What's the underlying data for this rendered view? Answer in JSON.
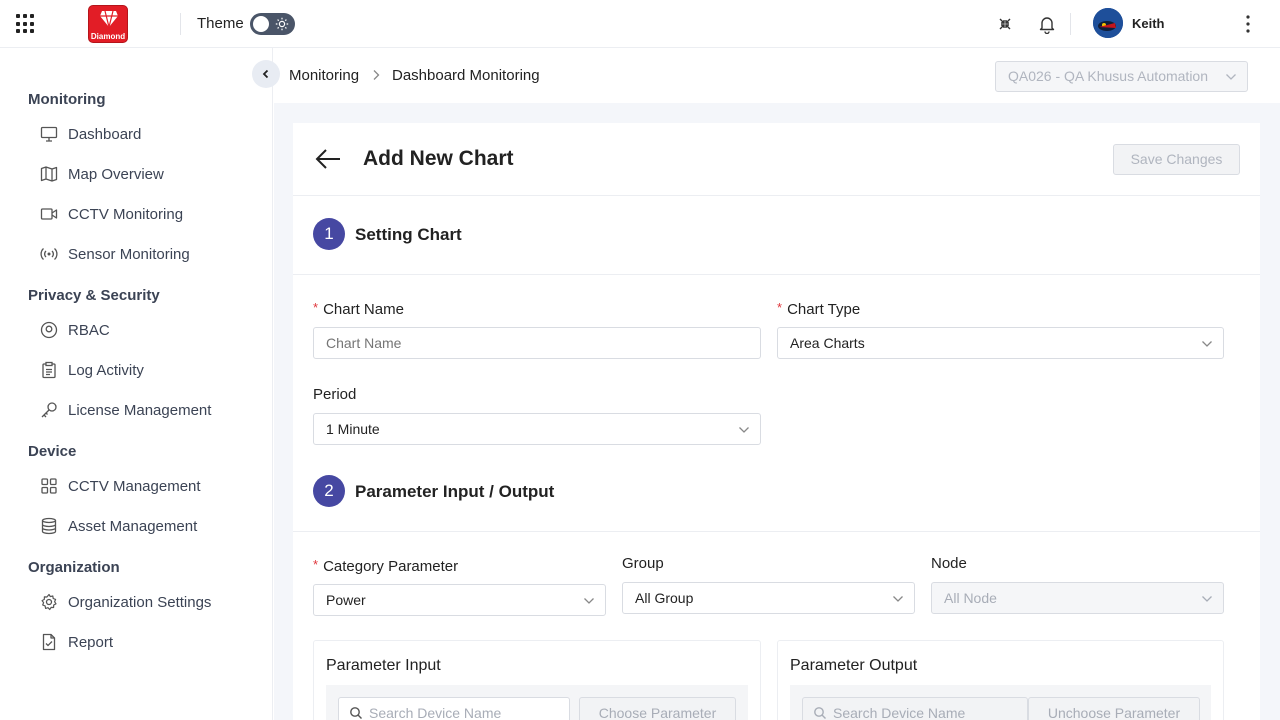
{
  "topbar": {
    "logo_text": "Diamond",
    "theme_label": "Theme",
    "user_name": "Keith"
  },
  "sidebar": {
    "sections": [
      {
        "title": "Monitoring",
        "items": [
          {
            "label": "Dashboard",
            "icon": "monitor-icon"
          },
          {
            "label": "Map Overview",
            "icon": "map-icon"
          },
          {
            "label": "CCTV Monitoring",
            "icon": "video-icon"
          },
          {
            "label": "Sensor Monitoring",
            "icon": "broadcast-icon"
          }
        ]
      },
      {
        "title": "Privacy & Security",
        "items": [
          {
            "label": "RBAC",
            "icon": "user-circle-icon"
          },
          {
            "label": "Log Activity",
            "icon": "clipboard-icon"
          },
          {
            "label": "License Management",
            "icon": "key-icon"
          }
        ]
      },
      {
        "title": "Device",
        "items": [
          {
            "label": "CCTV Management",
            "icon": "grid-icon"
          },
          {
            "label": "Asset Management",
            "icon": "database-icon"
          }
        ]
      },
      {
        "title": "Organization",
        "items": [
          {
            "label": "Organization Settings",
            "icon": "gear-icon"
          },
          {
            "label": "Report",
            "icon": "file-check-icon"
          }
        ]
      }
    ]
  },
  "breadcrumb": {
    "items": [
      "Monitoring",
      "Dashboard Monitoring"
    ]
  },
  "org_select": {
    "value": "QA026 - QA Khusus Automation"
  },
  "page": {
    "title": "Add New Chart",
    "save_label": "Save Changes"
  },
  "step1": {
    "number": "1",
    "title": "Setting Chart",
    "chart_name": {
      "label": "Chart Name",
      "placeholder": "Chart Name",
      "value": ""
    },
    "chart_type": {
      "label": "Chart Type",
      "value": "Area Charts"
    },
    "period": {
      "label": "Period",
      "value": "1 Minute"
    }
  },
  "step2": {
    "number": "2",
    "title": "Parameter Input / Output",
    "category": {
      "label": "Category Parameter",
      "value": "Power"
    },
    "group": {
      "label": "Group",
      "value": "All Group"
    },
    "node": {
      "label": "Node",
      "value": "All Node"
    },
    "input_panel": {
      "title": "Parameter Input",
      "search_placeholder": "Search Device Name",
      "button_label": "Choose Parameter"
    },
    "output_panel": {
      "title": "Parameter Output",
      "search_placeholder": "Search Device Name",
      "button_label": "Unchoose Parameter"
    }
  },
  "colors": {
    "accent": "#4648a2",
    "required": "#e0353b",
    "brand": "#e21d26"
  }
}
